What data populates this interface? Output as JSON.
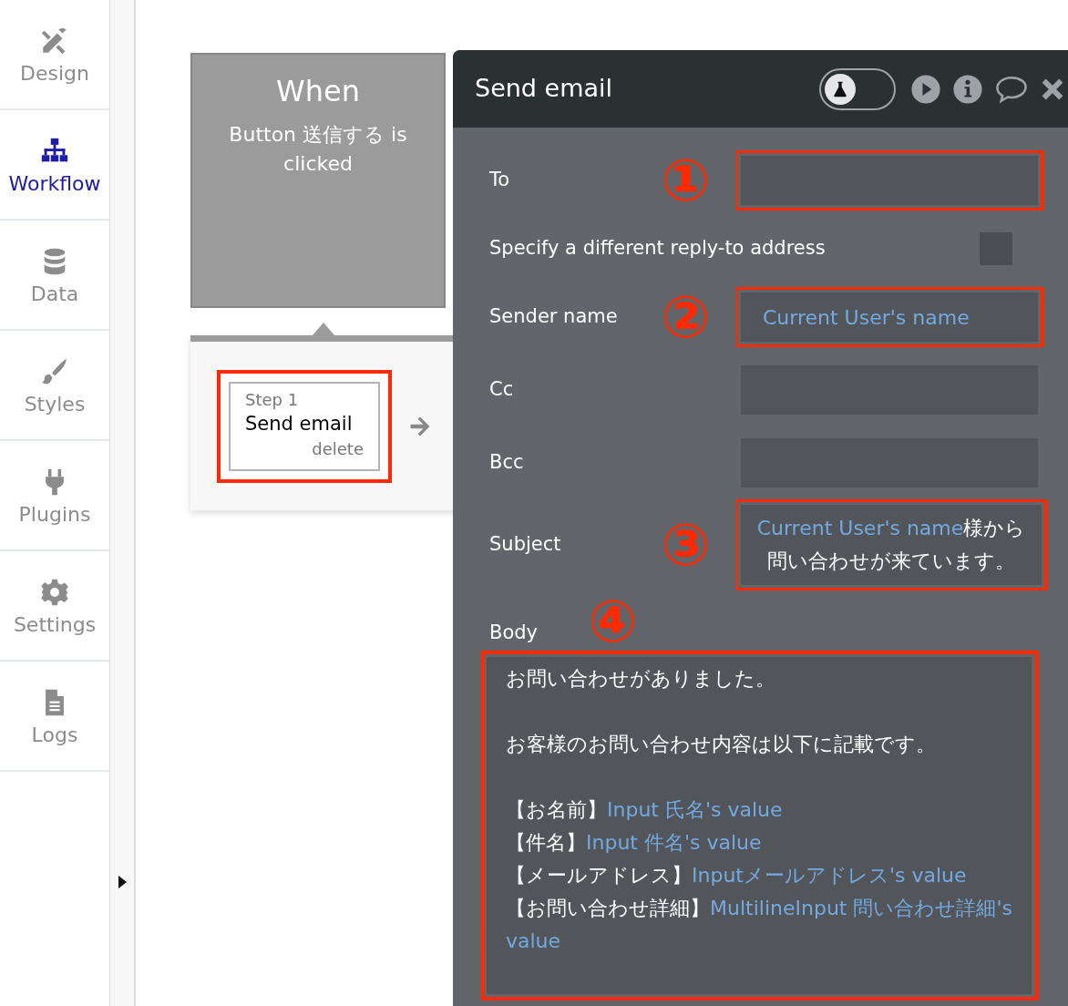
{
  "sidebar": {
    "items": [
      {
        "label": "Design",
        "selected": false
      },
      {
        "label": "Workflow",
        "selected": true
      },
      {
        "label": "Data",
        "selected": false
      },
      {
        "label": "Styles",
        "selected": false
      },
      {
        "label": "Plugins",
        "selected": false
      },
      {
        "label": "Settings",
        "selected": false
      },
      {
        "label": "Logs",
        "selected": false
      }
    ]
  },
  "workflow": {
    "event": {
      "title": "When",
      "description": "Button 送信する is clicked"
    },
    "steps": [
      {
        "step": "Step 1",
        "action": "Send email",
        "delete": "delete",
        "highlighted": true
      }
    ]
  },
  "panel": {
    "title": "Send email",
    "test_mode": false,
    "fields": [
      {
        "kind": "text",
        "label": "To",
        "annotation": "①",
        "highlighted": true
      },
      {
        "kind": "checkbox",
        "label": "Specify a different reply-to address",
        "checked": false
      },
      {
        "kind": "text",
        "label": "Sender name",
        "annotation": "②",
        "highlighted": true,
        "segments": [
          {
            "text": "Current User's name",
            "dynamic": true
          }
        ]
      },
      {
        "kind": "text",
        "label": "Cc",
        "highlighted": false
      },
      {
        "kind": "text",
        "label": "Bcc",
        "highlighted": false
      },
      {
        "kind": "multiline",
        "label": "Subject",
        "annotation": "③",
        "highlighted": true,
        "segments": [
          {
            "text": "Current User's name",
            "dynamic": true
          },
          {
            "text": "様から問い合わせが来ています。",
            "dynamic": false
          }
        ]
      },
      {
        "kind": "richtext",
        "label": "Body",
        "annotation": "④",
        "highlighted": true,
        "paragraphs": [
          {
            "lines": [
              [
                {
                  "text": "お問い合わせがありました。",
                  "dynamic": false
                }
              ]
            ]
          },
          {
            "lines": [
              [
                {
                  "text": "お客様のお問い合わせ内容は以下に記載です。",
                  "dynamic": false
                }
              ]
            ]
          },
          {
            "lines": [
              [
                {
                  "text": "【お名前】",
                  "dynamic": false
                },
                {
                  "text": "Input 氏名's value",
                  "dynamic": true
                }
              ],
              [
                {
                  "text": "【件名】",
                  "dynamic": false
                },
                {
                  "text": "Input 件名's value",
                  "dynamic": true
                }
              ],
              [
                {
                  "text": "【メールアドレス】",
                  "dynamic": false
                },
                {
                  "text": "Inputメールアドレス's value",
                  "dynamic": true
                }
              ],
              [
                {
                  "text": "【お問い合わせ詳細】",
                  "dynamic": false
                },
                {
                  "text": "MultilineInput 問い合わせ詳細's value",
                  "dynamic": true
                }
              ]
            ]
          }
        ]
      }
    ]
  }
}
